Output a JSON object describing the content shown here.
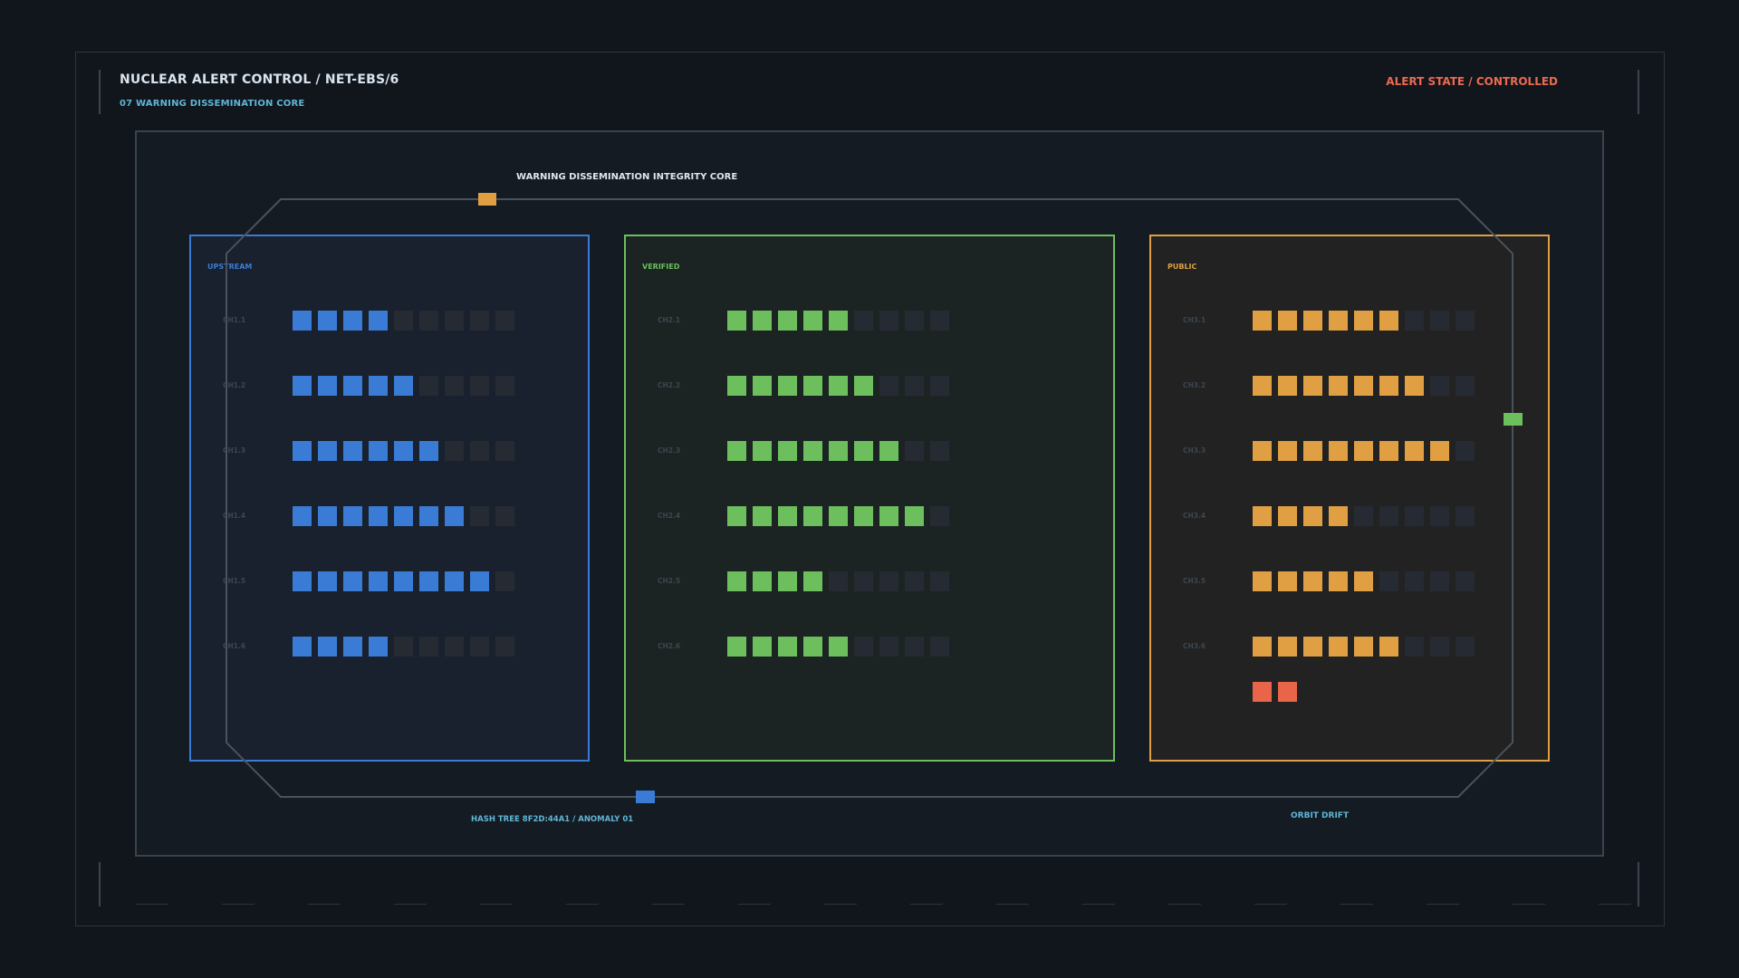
{
  "header": {
    "title": "NUCLEAR ALERT CONTROL / NET-EBS/6",
    "subtitle": "07  WARNING DISSEMINATION CORE",
    "alert_state": "ALERT STATE / CONTROLLED"
  },
  "core": {
    "label": "WARNING DISSEMINATION INTEGRITY CORE",
    "hash_label": "HASH TREE 8F2D:44A1 / ANOMALY 01",
    "orbit_label": "ORBIT DRIFT"
  },
  "colors": {
    "upstream": "#3a7bd5",
    "verified": "#6cbf5c",
    "public": "#e09f42",
    "anomaly": "#e8654a",
    "empty": "#262b33",
    "background": "#11161d"
  },
  "stages": [
    {
      "label": "UPSTREAM",
      "color_key": "upstream",
      "rows": [
        {
          "label": "CH1.1",
          "filled": 4,
          "total": 9
        },
        {
          "label": "CH1.2",
          "filled": 5,
          "total": 9
        },
        {
          "label": "CH1.3",
          "filled": 6,
          "total": 9
        },
        {
          "label": "CH1.4",
          "filled": 7,
          "total": 9
        },
        {
          "label": "CH1.5",
          "filled": 8,
          "total": 9
        },
        {
          "label": "CH1.6",
          "filled": 4,
          "total": 9
        }
      ],
      "anomalies": 0
    },
    {
      "label": "VERIFIED",
      "color_key": "verified",
      "rows": [
        {
          "label": "CH2.1",
          "filled": 5,
          "total": 9
        },
        {
          "label": "CH2.2",
          "filled": 6,
          "total": 9
        },
        {
          "label": "CH2.3",
          "filled": 7,
          "total": 9
        },
        {
          "label": "CH2.4",
          "filled": 8,
          "total": 9
        },
        {
          "label": "CH2.5",
          "filled": 4,
          "total": 9
        },
        {
          "label": "CH2.6",
          "filled": 5,
          "total": 9
        }
      ],
      "anomalies": 0
    },
    {
      "label": "PUBLIC",
      "color_key": "public",
      "rows": [
        {
          "label": "CH3.1",
          "filled": 6,
          "total": 9
        },
        {
          "label": "CH3.2",
          "filled": 7,
          "total": 9
        },
        {
          "label": "CH3.3",
          "filled": 8,
          "total": 9
        },
        {
          "label": "CH3.4",
          "filled": 4,
          "total": 9
        },
        {
          "label": "CH3.5",
          "filled": 5,
          "total": 9
        },
        {
          "label": "CH3.6",
          "filled": 6,
          "total": 9
        }
      ],
      "anomalies": 2
    }
  ],
  "markers": [
    {
      "name": "orbit-marker-orange",
      "color_key": "public"
    },
    {
      "name": "orbit-marker-green",
      "color_key": "verified"
    },
    {
      "name": "orbit-marker-blue",
      "color_key": "upstream"
    }
  ]
}
